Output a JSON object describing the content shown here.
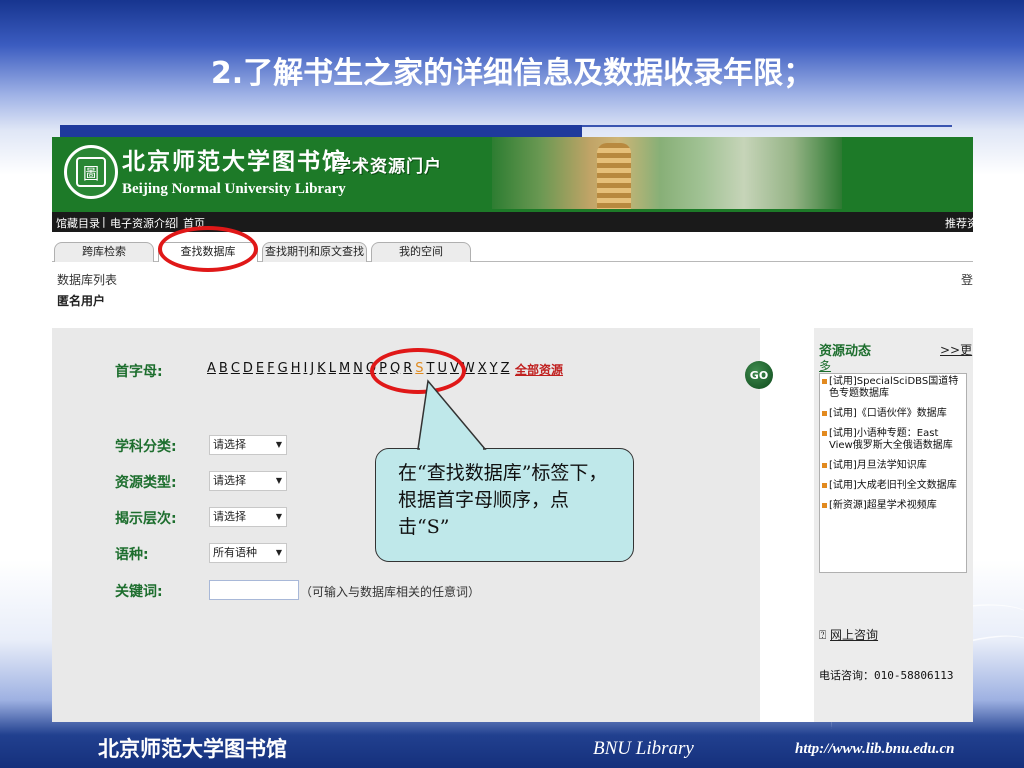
{
  "slide": {
    "title": "2.了解书生之家的详细信息及数据收录年限；",
    "footer_cn": "北京师范大学图书馆",
    "footer_en": "BNU Library",
    "footer_url": "http://www.lib.bnu.edu.cn"
  },
  "header": {
    "logo_glyph": "圖",
    "library_cn": "北京师范大学图书馆",
    "library_en": "Beijing Normal University Library",
    "portal_label": "学术资源门户"
  },
  "navbar": {
    "items": [
      "馆藏目录",
      "电子资源介绍",
      "首页"
    ],
    "right": "推荐资"
  },
  "tabs": [
    "跨库检索",
    "查找数据库",
    "查找期刊和原文查找",
    "我的空间"
  ],
  "page": {
    "db_list": "数据库列表",
    "user": "匿名用户",
    "edge_char": "登"
  },
  "search": {
    "initial_label": "首字母:",
    "letters": [
      "A",
      "B",
      "C",
      "D",
      "E",
      "F",
      "G",
      "H",
      "I",
      "J",
      "K",
      "L",
      "M",
      "N",
      "O",
      "P",
      "Q",
      "R",
      "S",
      "T",
      "U",
      "V",
      "W",
      "X",
      "Y",
      "Z"
    ],
    "selected_letter": "S",
    "all_resources": "全部资源",
    "go_label": "GO",
    "subject_label": "学科分类:",
    "subject_value": "请选择",
    "type_label": "资源类型:",
    "type_value": "请选择",
    "level_label": "揭示层次:",
    "level_value": "请选择",
    "language_label": "语种:",
    "language_value": "所有语种",
    "keyword_label": "关键词:",
    "keyword_value": "",
    "keyword_hint": "（可输入与数据库相关的任意词）"
  },
  "sidebar": {
    "title": "资源动态",
    "more_label": ">>更",
    "more_tail": "多",
    "news": [
      "[试用]SpecialSciDBS国道特色专题数据库",
      "[试用]《口语伙伴》数据库",
      "[试用]小语种专题：East View俄罗斯大全俄语数据库",
      "[试用]月旦法学知识库",
      "[试用]大成老旧刊全文数据库",
      "[新资源]超星学术视频库"
    ],
    "consult_icon": "question-icon",
    "consult_label": "网上咨询",
    "phone": "电话咨询：010-58806113"
  },
  "annotation": {
    "callout_text": "在“查找数据库”标签下，根据首字母顺序，点击“S”",
    "highlight_color": "#e01818",
    "callout_fill": "#bfe8ea"
  },
  "colors": {
    "slide_blue": "#17358f",
    "banner_green": "#1d7a28",
    "label_green": "#1d6e2e",
    "accent_red": "#c0201f",
    "selected_orange": "#e08a1e"
  }
}
